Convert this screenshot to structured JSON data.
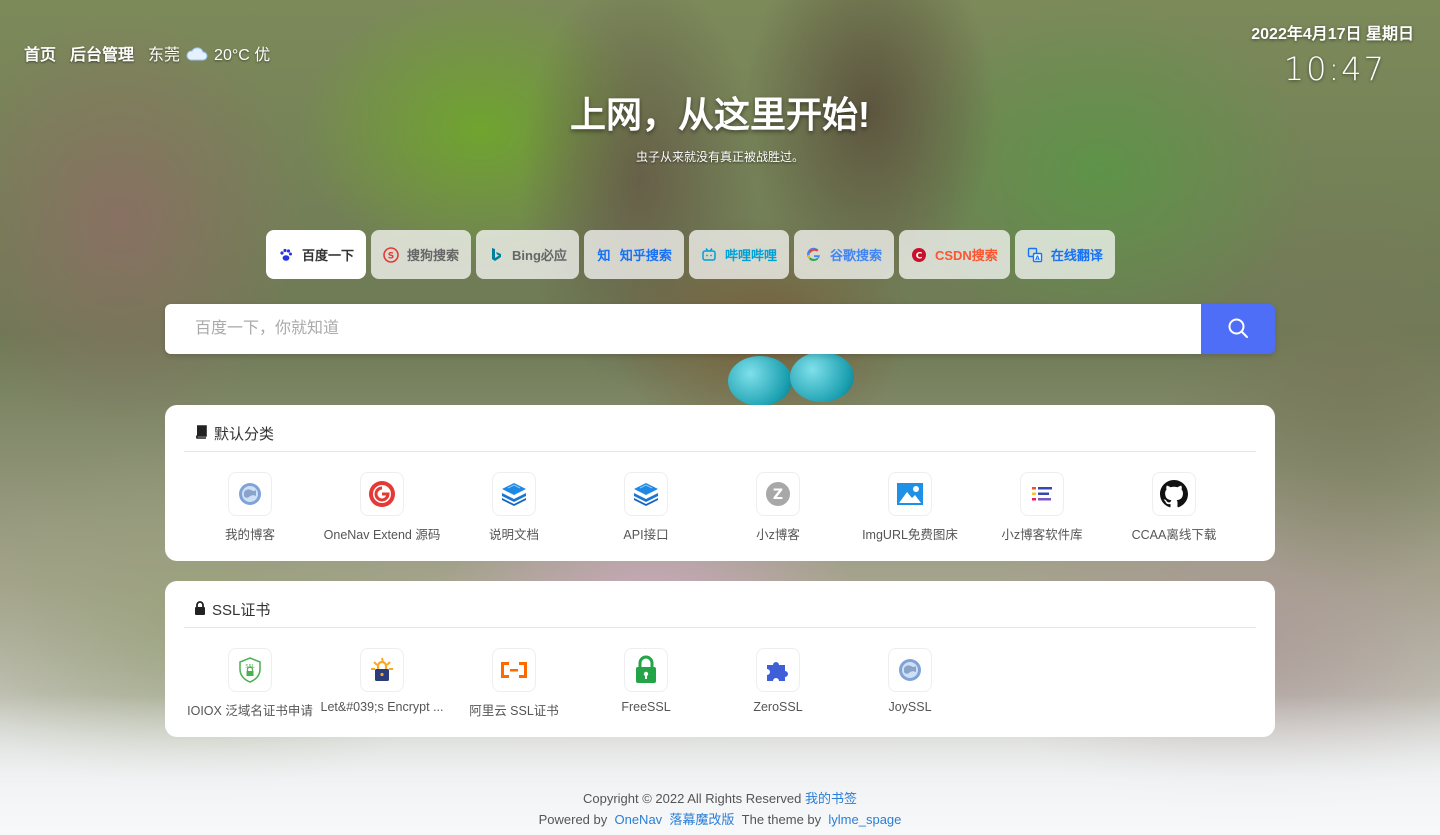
{
  "nav": {
    "home": "首页",
    "admin": "后台管理",
    "city": "东莞",
    "weather": "20°C 优"
  },
  "datetime": {
    "date": "2022年4月17日 星期日",
    "time": "10:47"
  },
  "hero": {
    "title": "上网，从这里开始!",
    "subtitle": "虫子从来就没有真正被战胜过。"
  },
  "engines": [
    {
      "label": "百度一下",
      "icon": "paw-icon",
      "color": "#333333",
      "active": true
    },
    {
      "label": "搜狗搜索",
      "icon": "sogou-icon",
      "color": "#666666"
    },
    {
      "label": "Bing必应",
      "icon": "bing-icon",
      "color": "#666666"
    },
    {
      "label": "知乎搜索",
      "icon": "zhihu-icon",
      "color": "#1772f6"
    },
    {
      "label": "哔哩哔哩",
      "icon": "bilibili-icon",
      "color": "#00a1d6"
    },
    {
      "label": "谷歌搜索",
      "icon": "google-icon",
      "color": "#4285f4"
    },
    {
      "label": "CSDN搜索",
      "icon": "csdn-icon",
      "color": "#fc5531"
    },
    {
      "label": "在线翻译",
      "icon": "translate-icon",
      "color": "#1772f6"
    }
  ],
  "search": {
    "placeholder": "百度一下，你就知道"
  },
  "categories": [
    {
      "title": "默认分类",
      "icon": "book-icon",
      "links": [
        {
          "label": "我的博客",
          "icon": "globe-icon"
        },
        {
          "label": "OneNav Extend 源码",
          "icon": "onenav-icon"
        },
        {
          "label": "说明文档",
          "icon": "layers-icon"
        },
        {
          "label": "API接口",
          "icon": "layers-icon"
        },
        {
          "label": "小z博客",
          "icon": "z-icon"
        },
        {
          "label": "ImgURL免费图床",
          "icon": "image-icon"
        },
        {
          "label": "小z博客软件库",
          "icon": "list-icon"
        },
        {
          "label": "CCAA离线下载",
          "icon": "github-icon"
        }
      ]
    },
    {
      "title": "SSL证书",
      "icon": "lock-icon",
      "links": [
        {
          "label": "IOIOX 泛域名证书申请",
          "icon": "ssl-shield-icon"
        },
        {
          "label": "Let&#039;s Encrypt ...",
          "icon": "letsencrypt-icon"
        },
        {
          "label": "阿里云 SSL证书",
          "icon": "aliyun-icon"
        },
        {
          "label": "FreeSSL",
          "icon": "freessl-lock-icon"
        },
        {
          "label": "ZeroSSL",
          "icon": "puzzle-icon"
        },
        {
          "label": "JoySSL",
          "icon": "globe-icon"
        }
      ]
    }
  ],
  "footer": {
    "copyright": "Copyright © 2022 All Rights Reserved",
    "site_link": "我的书签",
    "powered_by": "Powered by",
    "onenav": "OneNav",
    "modded": "落幕魔改版",
    "theme_by": "The theme by",
    "theme": "lylme_spage"
  },
  "colors": {
    "accent": "#4f6ef7",
    "link": "#2b7ed6"
  }
}
